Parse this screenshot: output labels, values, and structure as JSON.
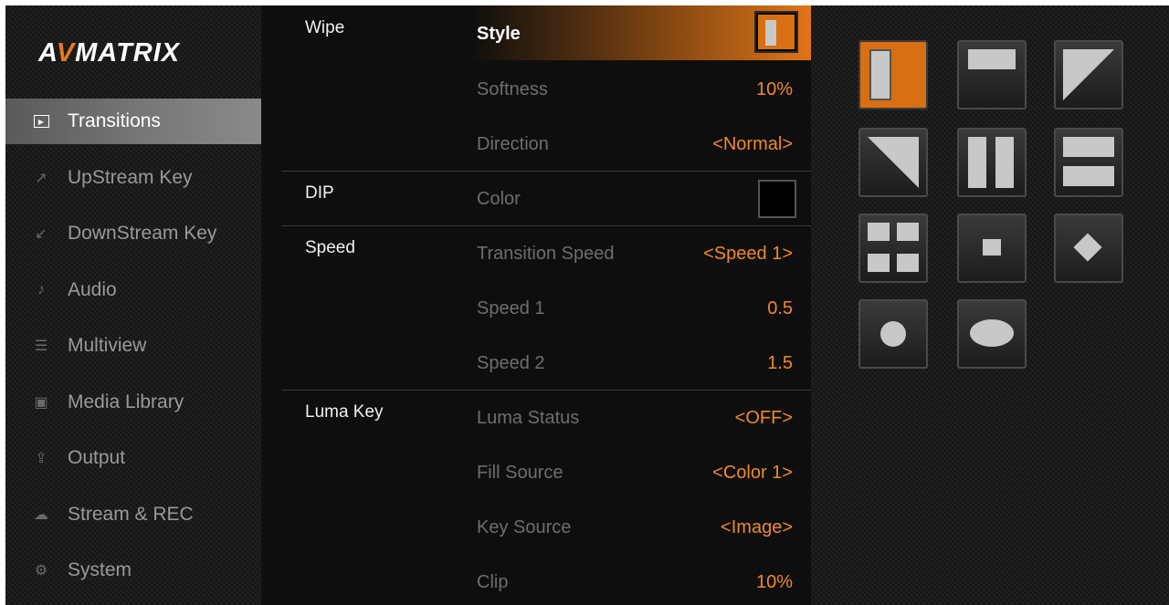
{
  "brand": {
    "logo_pre": "A",
    "logo_v": "V",
    "logo_post": "MATRIX"
  },
  "nav": [
    {
      "label": "Transitions",
      "icon": "play-box-icon",
      "active": true
    },
    {
      "label": "UpStream Key",
      "icon": "external-link-icon",
      "active": false
    },
    {
      "label": "DownStream Key",
      "icon": "inward-box-icon",
      "active": false
    },
    {
      "label": "Audio",
      "icon": "speaker-icon",
      "active": false
    },
    {
      "label": "Multiview",
      "icon": "list-icon",
      "active": false
    },
    {
      "label": "Media Library",
      "icon": "image-icon",
      "active": false
    },
    {
      "label": "Output",
      "icon": "upload-icon",
      "active": false
    },
    {
      "label": "Stream & REC",
      "icon": "cloud-icon",
      "active": false
    },
    {
      "label": "System",
      "icon": "gear-icon",
      "active": false
    }
  ],
  "settings": {
    "wipe": {
      "category": "Wipe",
      "style_label": "Style",
      "softness_label": "Softness",
      "softness_value": "10%",
      "direction_label": "Direction",
      "direction_value": "<Normal>"
    },
    "dip": {
      "category": "DIP",
      "color_label": "Color",
      "color_value_hex": "#000000"
    },
    "speed": {
      "category": "Speed",
      "transition_speed_label": "Transition Speed",
      "transition_speed_value": "<Speed 1>",
      "speed1_label": "Speed 1",
      "speed1_value": "0.5",
      "speed2_label": "Speed 2",
      "speed2_value": "1.5"
    },
    "luma": {
      "category": "Luma Key",
      "status_label": "Luma Status",
      "status_value": "<OFF>",
      "fill_label": "Fill Source",
      "fill_value": "<Color 1>",
      "key_label": "Key Source",
      "key_value": "<Image>",
      "clip_label": "Clip",
      "clip_value": "10%"
    }
  },
  "wipe_styles": [
    {
      "name": "wipe-vertical-bar",
      "selected": true
    },
    {
      "name": "wipe-horizontal-bar",
      "selected": false
    },
    {
      "name": "wipe-diagonal-top-right",
      "selected": false
    },
    {
      "name": "wipe-diagonal-bottom-left",
      "selected": false
    },
    {
      "name": "wipe-split-vertical",
      "selected": false
    },
    {
      "name": "wipe-split-horizontal",
      "selected": false
    },
    {
      "name": "wipe-four-corners",
      "selected": false
    },
    {
      "name": "wipe-box-center",
      "selected": false
    },
    {
      "name": "wipe-diamond",
      "selected": false
    },
    {
      "name": "wipe-circle",
      "selected": false
    },
    {
      "name": "wipe-ellipse",
      "selected": false
    }
  ],
  "colors": {
    "accent": "#e07416",
    "value_text": "#f08a2a"
  }
}
